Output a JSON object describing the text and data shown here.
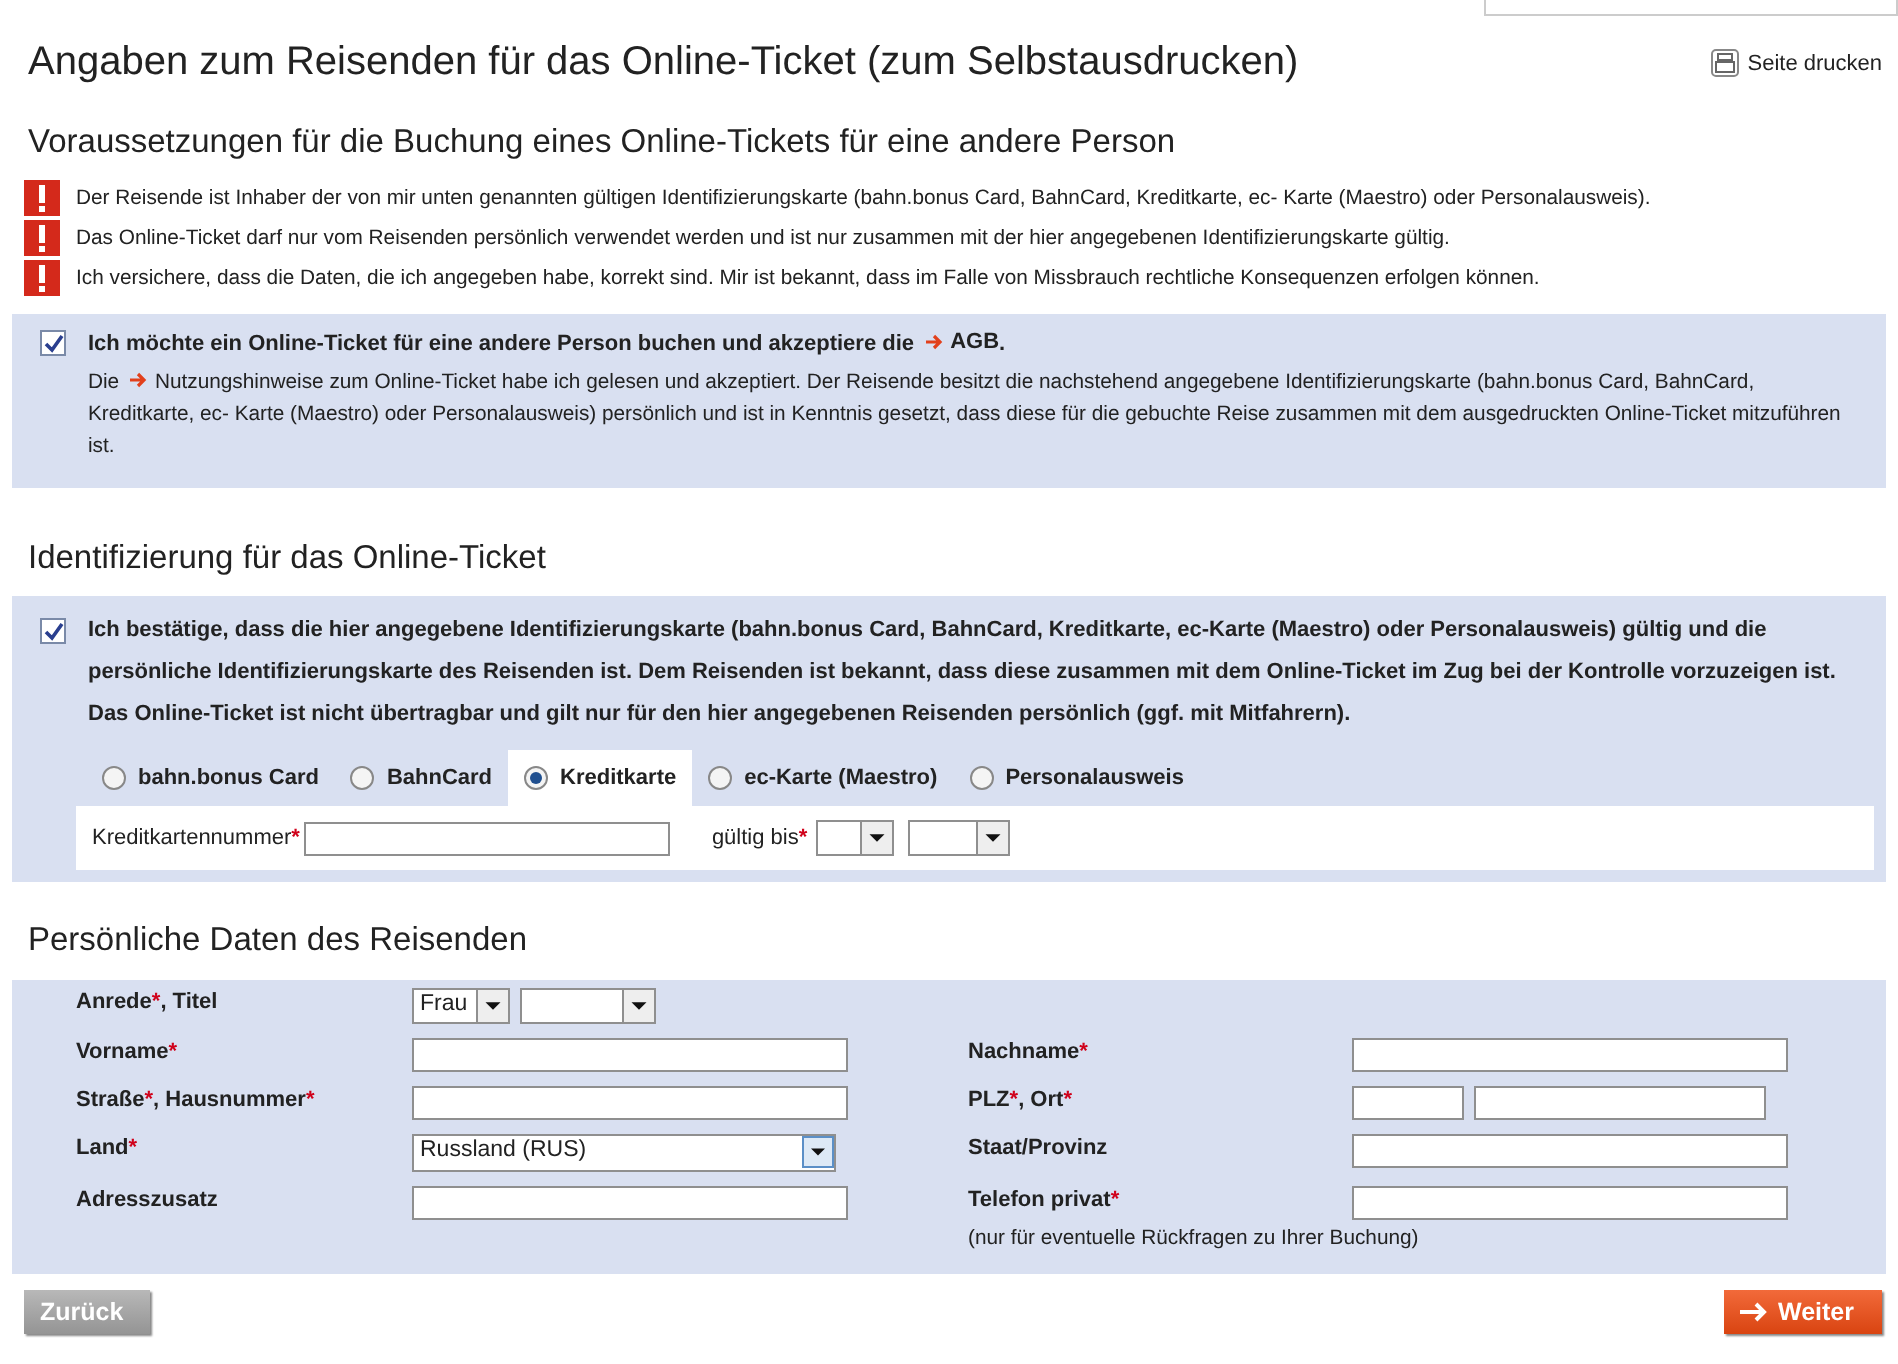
{
  "title": "Angaben zum Reisenden für das Online-Ticket (zum Selbstausdrucken)",
  "print_link": "Seite drucken",
  "requirements": {
    "heading": "Voraussetzungen für die Buchung eines Online-Tickets für eine andere Person",
    "notices": [
      "Der Reisende ist Inhaber der von mir unten genannten gültigen Identifizierungskarte (bahn.bonus Card, BahnCard, Kreditkarte, ec- Karte (Maestro) oder Personalausweis).",
      "Das Online-Ticket darf nur vom Reisenden persönlich verwendet werden und ist nur zusammen mit der hier angegebenen Identifizierungskarte gültig.",
      "Ich versichere, dass die Daten, die ich angegeben habe, korrekt sind. Mir ist bekannt, dass im Falle von Missbrauch rechtliche Konsequenzen erfolgen können."
    ],
    "consent": {
      "checked": true,
      "text": "Ich möchte ein Online-Ticket für eine andere Person buchen und akzeptiere die",
      "link": "AGB",
      "text_after": ".",
      "note_before": "Die",
      "note_link": "Nutzungshinweise",
      "note_after": "zum Online-Ticket habe ich gelesen und akzeptiert. Der Reisende besitzt die nachstehend angegebene Identifizierungskarte (bahn.bonus Card, BahnCard, Kreditkarte, ec- Karte (Maestro) oder Personalausweis) persönlich und ist in Kenntnis gesetzt, dass diese für die gebuchte Reise zusammen mit dem ausgedruckten Online-Ticket mitzuführen ist."
    }
  },
  "identification": {
    "heading": "Identifizierung für das Online-Ticket",
    "confirm": {
      "checked": true,
      "text": "Ich bestätige, dass die hier angegebene Identifizierungskarte (bahn.bonus Card, BahnCard, Kreditkarte, ec-Karte (Maestro) oder Personalausweis) gültig und die persönliche Identifizierungskarte des Reisenden ist. Dem Reisenden ist bekannt, dass diese zusammen mit dem Online-Ticket im Zug bei der Kontrolle vorzuzeigen ist. Das Online-Ticket ist nicht übertragbar und gilt nur für den hier angegebenen Reisenden persönlich (ggf. mit Mitfahrern)."
    },
    "id_types": [
      {
        "label": "bahn.bonus Card",
        "selected": false
      },
      {
        "label": "BahnCard",
        "selected": false
      },
      {
        "label": "Kreditkarte",
        "selected": true
      },
      {
        "label": "ec-Karte (Maestro)",
        "selected": false
      },
      {
        "label": "Personalausweis",
        "selected": false
      }
    ],
    "card_number_label": "Kreditkartennummer*",
    "valid_until_label": "gültig bis*"
  },
  "personal": {
    "heading": "Persönliche Daten des Reisenden",
    "rows": [
      {
        "left": {
          "label": "Anrede*, Titel",
          "kind": "selects",
          "value": "Frau"
        },
        "right": null
      },
      {
        "left": {
          "label": "Vorname*",
          "kind": "text"
        },
        "right": {
          "label": "Nachname*",
          "kind": "text"
        }
      },
      {
        "left": {
          "label": "Straße*, Hausnummer*",
          "kind": "text"
        },
        "right": {
          "label": "PLZ*, Ort*",
          "kind": "split"
        }
      },
      {
        "left": {
          "label": "Land*",
          "kind": "select",
          "value": "Russland (RUS)"
        },
        "right": {
          "label": "Staat/Provinz",
          "kind": "text"
        }
      },
      {
        "left": {
          "label": "Adresszusatz",
          "kind": "text"
        },
        "right": {
          "label": "Telefon privat*",
          "kind": "text",
          "hint": "(nur für eventuelle Rückfragen zu Ihrer Buchung)"
        }
      }
    ]
  },
  "buttons": {
    "back": "Zurück",
    "next": "Weiter"
  }
}
